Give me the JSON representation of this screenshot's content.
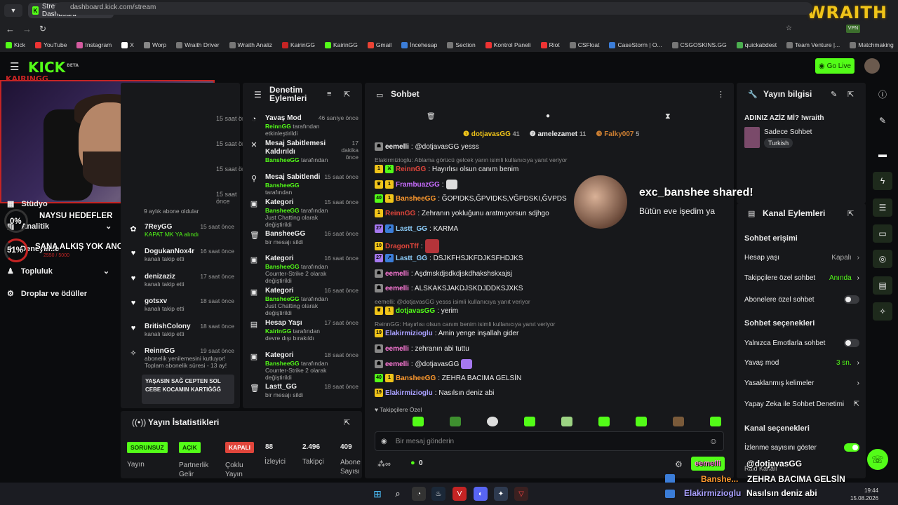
{
  "browser": {
    "tab_title": "Stream - Kick Dashboard",
    "url": "dashboard.kick.com/stream",
    "overlay_logo": "WRAITH",
    "bookmarks": [
      "Kick",
      "YouTube",
      "Instagram",
      "X",
      "Worp",
      "Wraith Driver",
      "Wraith Analiz",
      "KairinGG",
      "KairinGG",
      "Gmail",
      "İncehesap",
      "Section",
      "Kontrol Paneli",
      "Riot",
      "CSFloat",
      "CaseStorm | O...",
      "CSGOSKINS.GG",
      "quickabdest",
      "Team Venture |...",
      "Matchmaking"
    ]
  },
  "topnav": {
    "logo": "KICK",
    "beta": "BETA",
    "go_live": "Go Live"
  },
  "stream_overlay": {
    "webcam_tag": "KAIRINGG",
    "goal1_pct": "0%",
    "goal1_text": "NAYSU HEDEFLER",
    "goal2_pct": "51%",
    "goal2_text": "SANA ALKIŞ YOK ANCA KICK",
    "goal2_sub": "2550 / 5000",
    "shared_title": "exc_banshee shared!",
    "shared_text": "Bütün eve işedim ya",
    "bottom_name": "@dotjavasGG",
    "bottom_sender": "eemelli",
    "bottom_line2_user": "Banshe...",
    "bottom_line2_text": "ZEHRA BACIMA GELSİN",
    "bottom_line3_user": "Elakirmizioglu",
    "bottom_line3_text": "Nasılsın deniz abi"
  },
  "sidebar": {
    "items": [
      {
        "label": "Stüdyo"
      },
      {
        "label": "Analitik"
      },
      {
        "label": "Deneyimle"
      },
      {
        "label": "Topluluk"
      },
      {
        "label": "Droplar ve ödüller"
      }
    ]
  },
  "activity": {
    "times_top": [
      "15 saat önce",
      "15 saat önce",
      "15 saat önce",
      "15 saat önce"
    ],
    "first_desc": "9 aylık abone oldular",
    "items": [
      {
        "name": "7ReyGG",
        "time": "15 saat önce",
        "desc": "KAPAT MK YA alındı"
      },
      {
        "name": "DogukanNox4r",
        "time": "16 saat önce",
        "desc": "kanalı takip etti"
      },
      {
        "name": "denizaziz",
        "time": "17 saat önce",
        "desc": "kanalı takip etti"
      },
      {
        "name": "gotsxv",
        "time": "18 saat önce",
        "desc": "kanalı takip etti"
      },
      {
        "name": "BritishColony",
        "time": "18 saat önce",
        "desc": "kanalı takip etti"
      },
      {
        "name": "ReinnGG",
        "time": "19 saat önce",
        "desc": "abonelik yenilemesini kutluyor! Toplam abonelik süresi - 13 ay!",
        "note": "YAŞASIN SAĞ CEPTEN SOL CEBE KOCAMIN KARTIĞĞĞ"
      }
    ]
  },
  "moderation": {
    "title": "Denetim Eylemleri",
    "items": [
      {
        "name": "Yavaş Mod",
        "time": "46 saniye önce",
        "who": "ReinnGG",
        "rest": " tarafından etkinleştirildi"
      },
      {
        "name": "Mesaj Sabitlemesi Kaldırıldı",
        "time": "17 dakika önce",
        "who": "BansheeGG",
        "rest": " tarafından"
      },
      {
        "name": "Mesaj Sabitlendi",
        "time": "15 saat önce",
        "who": "BansheeGG",
        "rest": " tarafından"
      },
      {
        "name": "Kategori",
        "time": "15 saat önce",
        "who": "BansheeGG",
        "rest": " tarafından Just Chatting olarak değiştirildi"
      },
      {
        "name": "BansheeGG",
        "time": "16 saat önce",
        "who": "",
        "rest": "bir mesajı sildi"
      },
      {
        "name": "Kategori",
        "time": "16 saat önce",
        "who": "BansheeGG",
        "rest": " tarafından Counter-Strike 2 olarak değiştirildi"
      },
      {
        "name": "Kategori",
        "time": "16 saat önce",
        "who": "BansheeGG",
        "rest": " tarafından Just Chatting olarak değiştirildi"
      },
      {
        "name": "Hesap Yaşı",
        "time": "17 saat önce",
        "who": "KairinGG",
        "rest": " tarafından devre dışı bırakıldı"
      },
      {
        "name": "Kategori",
        "time": "18 saat önce",
        "who": "BansheeGG",
        "rest": " tarafından Counter-Strike 2 olarak değiştirildi"
      },
      {
        "name": "Lastt_GG",
        "time": "18 saat önce",
        "who": "",
        "rest": "bir mesajı sildi"
      }
    ]
  },
  "stats": {
    "title": "Yayın İstatistikleri",
    "badges": [
      {
        "text": "SORUNSUZ",
        "label": "Yayın"
      },
      {
        "text": "AÇIK",
        "label": "Partnerlik Gelir"
      },
      {
        "text": "KAPALI",
        "label": "Çoklu Yayın"
      }
    ],
    "numbers": [
      {
        "value": "88",
        "label": "İzleyici"
      },
      {
        "value": "2.496",
        "label": "Takipçi"
      },
      {
        "value": "409",
        "label": "Abone Sayısı"
      }
    ]
  },
  "chat": {
    "title": "Sohbet",
    "top_gifters": [
      {
        "name": "dotjavasGG",
        "count": "41"
      },
      {
        "name": "amelezamet",
        "count": "11"
      },
      {
        "name": "Falky007",
        "count": "5"
      }
    ],
    "messages": [
      {
        "user": "eemelli",
        "color": "#f0f0f0",
        "text": ": @dotjavasGG yesss"
      },
      {
        "reply": "Elakirmizioglu: Ablama görücü gelcek yarın isimli kullanıcıya yanıt veriyor"
      },
      {
        "user": "ReinnGG",
        "color": "#e0453b",
        "text": ": Hayırlısı olsun canım benim"
      },
      {
        "user": "FrambuazGG",
        "color": "#c86dff",
        "text": ":"
      },
      {
        "user": "BansheeGG",
        "color": "#ff9a2e",
        "text": ": ĞOPIDKS,ĞPVIDKS,VĞPDSKI,ĞVPDS"
      },
      {
        "user": "ReinnGG",
        "color": "#e0453b",
        "text": ": Zehranın yokluğunu aratmıyorsun sdjhgo"
      },
      {
        "user": "Lastt_GG",
        "color": "#8fd1ff",
        "text": ": KARMA"
      },
      {
        "user": "DragonTff",
        "color": "#e0453b",
        "text": ":"
      },
      {
        "user": "Lastt_GG",
        "color": "#8fd1ff",
        "text": ": DSJKFHSJKFDJKSFHDJKS"
      },
      {
        "user": "eemelli",
        "color": "#ff7ad9",
        "text": ": Aşdmskdjsdkdjskdhakshskxajsj"
      },
      {
        "user": "eemelli",
        "color": "#ff7ad9",
        "text": ": ALSKAKSJAKDJSKDJDDKSJXKS"
      },
      {
        "reply": "eemelli: @dotjavasGG yesss isimli kullanıcıya yanıt veriyor"
      },
      {
        "user": "dotjavasGG",
        "color": "#53fc18",
        "text": ": yerim"
      },
      {
        "reply": "ReinnGG: Hayırlısı olsun canım benim isimli kullanıcıya yanıt veriyor"
      },
      {
        "user": "Elakirmizioglu",
        "color": "#a9a0ff",
        "text": ": Amin yenge inşallah gider"
      },
      {
        "user": "eemelli",
        "color": "#ff7ad9",
        "text": ": zehranın abi tuttu"
      },
      {
        "user": "eemelli",
        "color": "#ff7ad9",
        "text": ": @dotjavasGG"
      },
      {
        "user": "BansheeGG",
        "color": "#ff9a2e",
        "text": ": ZEHRA BACIMA GELSİN"
      },
      {
        "user": "Elakirmizioglu",
        "color": "#a9a0ff",
        "text": ": Nasılsın deniz abi"
      }
    ],
    "followers_only": "Takipçilere Özel",
    "input_placeholder": "Bir mesaj gönderin",
    "points": "0",
    "send": "Gönder"
  },
  "info": {
    "title": "Yayın bilgisi",
    "stream_title": "ADINIZ AZİZ Mİ? !wraith",
    "category": "Sadece Sohbet",
    "language": "Turkish"
  },
  "actions": {
    "title": "Kanal Eylemleri",
    "chat_access": "Sohbet erişimi",
    "account_age": {
      "label": "Hesap yaşı",
      "value": "Kapalı"
    },
    "follower_chat": {
      "label": "Takipçilere özel sohbet",
      "value": "Anında"
    },
    "sub_chat": {
      "label": "Abonelere özel sohbet"
    },
    "chat_options": "Sohbet seçenekleri",
    "emote_only": {
      "label": "Yalnızca Emotlarla sohbet"
    },
    "slow_mode": {
      "label": "Yavaş mod",
      "value": "3 sn."
    },
    "banned_words": {
      "label": "Yasaklanmış kelimeler"
    },
    "ai_moderation": {
      "label": "Yapay Zeka ile Sohbet Denetimi"
    },
    "channel_options": "Kanal seçenekleri",
    "show_viewers": {
      "label": "İzlenme sayısını göster"
    },
    "raid": {
      "label": "Raid Kanalı"
    }
  },
  "taskbar": {
    "time": "19:44",
    "date": "15.08.2026"
  },
  "colors": {
    "accent": "#53fc18",
    "panel": "#17181b",
    "bg": "#0b0c0e",
    "alert": "#e0453b"
  }
}
